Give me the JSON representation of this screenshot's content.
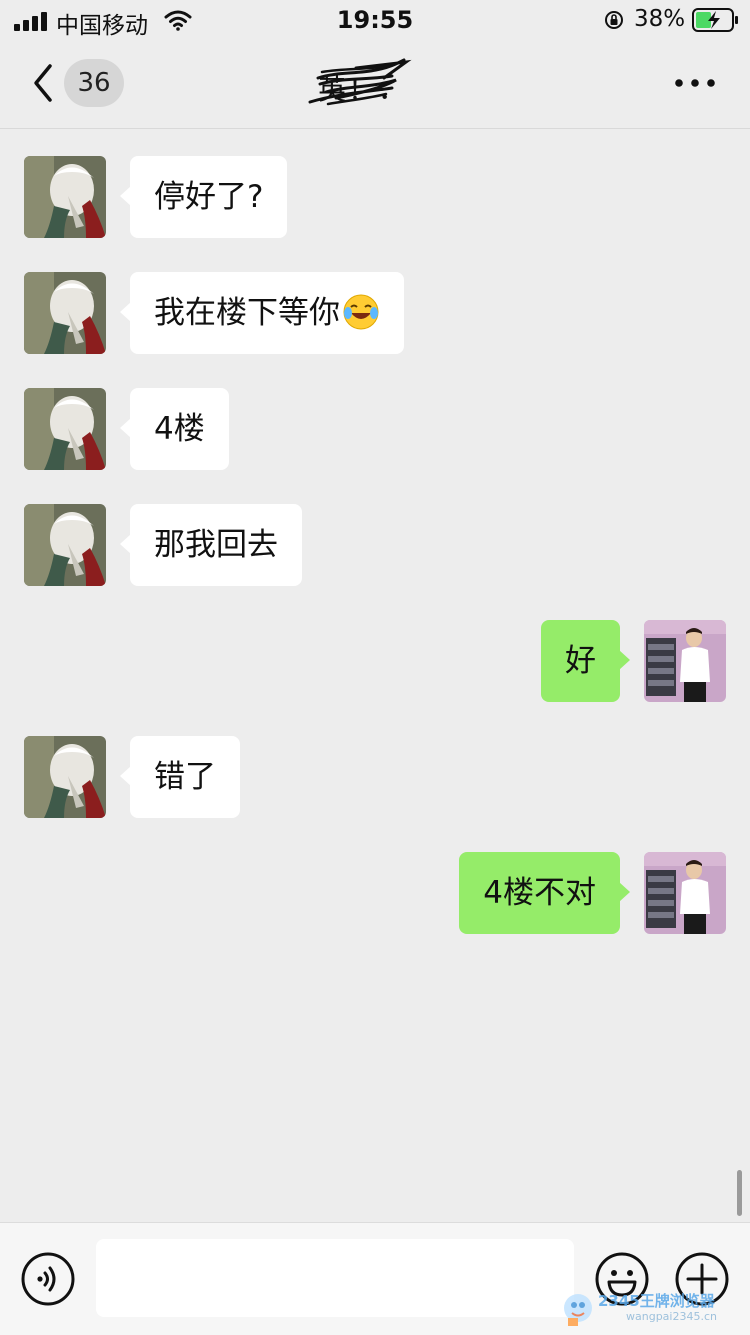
{
  "status_bar": {
    "carrier": "中国移动",
    "time": "19:55",
    "battery_percent": "38%",
    "icons": [
      "signal-icon",
      "wifi-icon",
      "orientation-lock-icon",
      "battery-charging-icon"
    ]
  },
  "nav": {
    "back_icon": "chevron-left-icon",
    "unread_count": "36",
    "title": "英！．",
    "more_icon": "more-dots-icon"
  },
  "messages": [
    {
      "side": "in",
      "text": "停好了?"
    },
    {
      "side": "in",
      "text": "我在楼下等你",
      "emoji": "laughing-tears-emoji"
    },
    {
      "side": "in",
      "text": "4楼"
    },
    {
      "side": "in",
      "text": "那我回去"
    },
    {
      "side": "out",
      "text": "好"
    },
    {
      "side": "in",
      "text": "错了"
    },
    {
      "side": "out",
      "text": "4楼不对"
    }
  ],
  "input_bar": {
    "voice_icon": "voice-icon",
    "placeholder": "",
    "emoji_icon": "emoji-smile-icon",
    "plus_icon": "plus-circle-icon"
  },
  "watermark": {
    "line1": "2345王牌浏览器",
    "line2": "wangpai2345.cn"
  },
  "colors": {
    "background": "#ededed",
    "incoming_bubble": "#ffffff",
    "outgoing_bubble": "#95ec69"
  }
}
